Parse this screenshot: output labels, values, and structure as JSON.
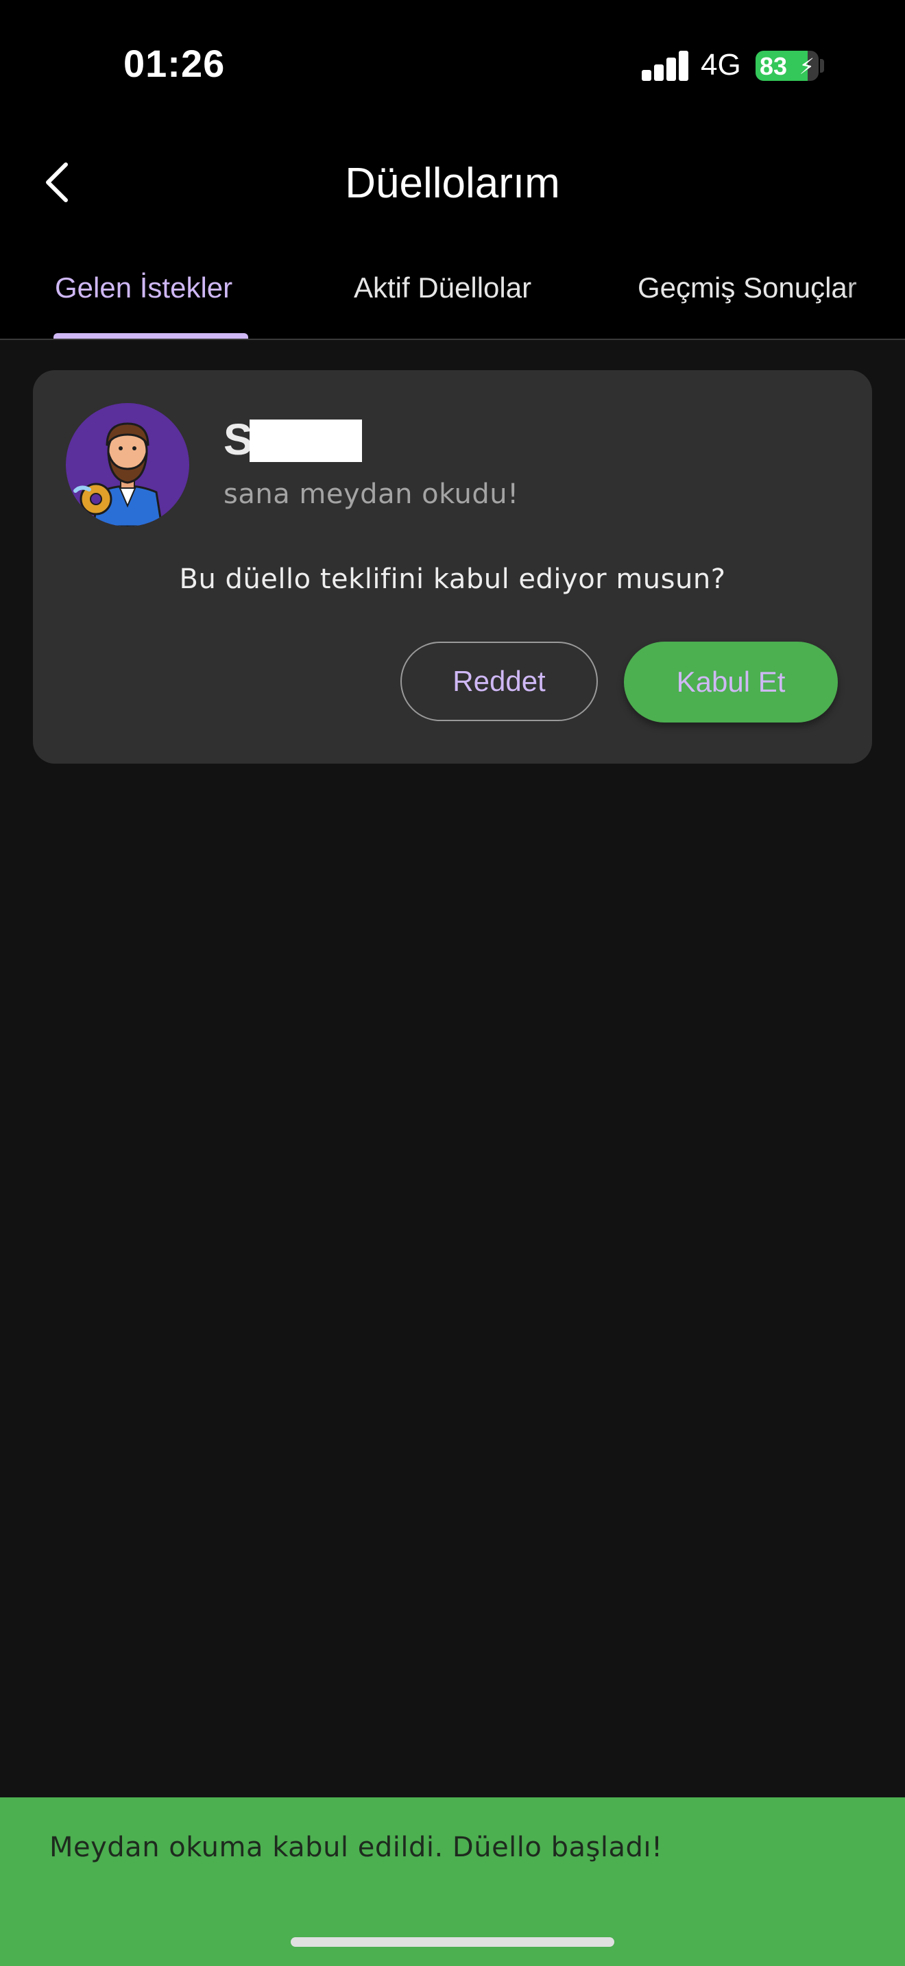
{
  "status_bar": {
    "time": "01:26",
    "network": "4G",
    "battery_level": "83",
    "battery_fraction": 0.83
  },
  "header": {
    "title": "Düellolarım",
    "back_icon": "chevron-left-icon"
  },
  "tabs": [
    {
      "label": "Gelen İstekler",
      "active": true
    },
    {
      "label": "Aktif Düellolar",
      "active": false
    },
    {
      "label": "Geçmiş Sonuçlar",
      "active": false
    }
  ],
  "request_card": {
    "challenger_name": "Sk",
    "avatar_icon": "bearded-man-avatar-icon",
    "subtitle": "sana meydan okudu!",
    "question": "Bu düello teklifini kabul ediyor musun?",
    "reject_label": "Reddet",
    "accept_label": "Kabul Et"
  },
  "snackbar": {
    "message": "Meydan okuma kabul edildi. Düello başladı!"
  },
  "colors": {
    "accent": "#cfb8f5",
    "success": "#4caf50",
    "card": "#303030",
    "background": "#121212"
  }
}
